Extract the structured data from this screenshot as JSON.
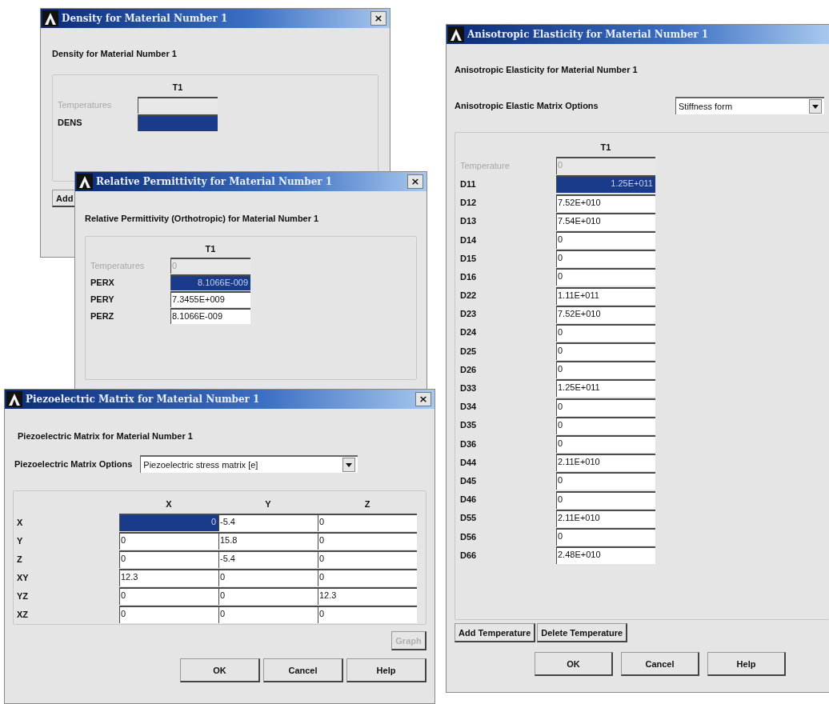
{
  "density_dialog": {
    "title": "Density for Material Number 1",
    "close_label": "×",
    "heading": "Density for Material Number 1",
    "column": "T1",
    "temperature_row": {
      "label": "Temperatures",
      "disabled": true
    },
    "rows": [
      {
        "label": "DENS",
        "selected": true
      }
    ],
    "buttons": [
      "Add"
    ]
  },
  "permittivity_dialog": {
    "title": "Relative Permittivity for Material Number 1",
    "close_label": "×",
    "heading": "Relative Permittivity (Orthotropic) for Material Number 1",
    "column": "T1",
    "temperature_row": {
      "label": "Temperatures",
      "value": "0",
      "disabled": true
    },
    "rows": [
      {
        "label": "PERX",
        "value": "8.1066E-009",
        "selected": true
      },
      {
        "label": "PERY",
        "value": "7.3455E+009",
        "selected": false
      },
      {
        "label": "PERZ",
        "value": "8.1066E-009",
        "selected": false
      }
    ]
  },
  "piezo_dialog": {
    "title": "Piezoelectric Matrix for Material Number 1",
    "close_label": "×",
    "heading": "Piezoelectric Matrix for Material Number 1",
    "options_label": "Piezoelectric Matrix Options",
    "options_value": "Piezoelectric stress matrix [e]",
    "columns": [
      "X",
      "Y",
      "Z"
    ],
    "rows": [
      {
        "label": "X",
        "cells": [
          {
            "value": "0",
            "selected": true
          },
          {
            "value": "-5.4",
            "selected": false
          },
          {
            "value": "0",
            "selected": false
          }
        ]
      },
      {
        "label": "Y",
        "cells": [
          {
            "value": "0",
            "selected": false
          },
          {
            "value": "15.8",
            "selected": false
          },
          {
            "value": "0",
            "selected": false
          }
        ]
      },
      {
        "label": "Z",
        "cells": [
          {
            "value": "0",
            "selected": false
          },
          {
            "value": "-5.4",
            "selected": false
          },
          {
            "value": "0",
            "selected": false
          }
        ]
      },
      {
        "label": "XY",
        "cells": [
          {
            "value": "12.3",
            "selected": false
          },
          {
            "value": "0",
            "selected": false
          },
          {
            "value": "0",
            "selected": false
          }
        ]
      },
      {
        "label": "YZ",
        "cells": [
          {
            "value": "0",
            "selected": false
          },
          {
            "value": "0",
            "selected": false
          },
          {
            "value": "12.3",
            "selected": false
          }
        ]
      },
      {
        "label": "XZ",
        "cells": [
          {
            "value": "0",
            "selected": false
          },
          {
            "value": "0",
            "selected": false
          },
          {
            "value": "0",
            "selected": false
          }
        ]
      }
    ],
    "graph_button": {
      "label": "Graph",
      "disabled": true
    },
    "buttons": [
      "OK",
      "Cancel",
      "Help"
    ]
  },
  "elasticity_dialog": {
    "title": "Anisotropic Elasticity  for Material Number 1",
    "heading": "Anisotropic Elasticity  for Material Number 1",
    "options_label": "Anisotropic Elastic Matrix Options",
    "options_value": "Stiffness form",
    "column": "T1",
    "temperature_row": {
      "label": "Temperature",
      "value": "0",
      "disabled": true
    },
    "rows": [
      {
        "label": "D11",
        "value": "1.25E+011",
        "selected": true
      },
      {
        "label": "D12",
        "value": "7.52E+010",
        "selected": false
      },
      {
        "label": "D13",
        "value": "7.54E+010",
        "selected": false
      },
      {
        "label": "D14",
        "value": "0",
        "selected": false
      },
      {
        "label": "D15",
        "value": "0",
        "selected": false
      },
      {
        "label": "D16",
        "value": "0",
        "selected": false
      },
      {
        "label": "D22",
        "value": "1.11E+011",
        "selected": false
      },
      {
        "label": "D23",
        "value": "7.52E+010",
        "selected": false
      },
      {
        "label": "D24",
        "value": "0",
        "selected": false
      },
      {
        "label": "D25",
        "value": "0",
        "selected": false
      },
      {
        "label": "D26",
        "value": "0",
        "selected": false
      },
      {
        "label": "D33",
        "value": "1.25E+011",
        "selected": false
      },
      {
        "label": "D34",
        "value": "0",
        "selected": false
      },
      {
        "label": "D35",
        "value": "0",
        "selected": false
      },
      {
        "label": "D36",
        "value": "0",
        "selected": false
      },
      {
        "label": "D44",
        "value": "2.11E+010",
        "selected": false
      },
      {
        "label": "D45",
        "value": "0",
        "selected": false
      },
      {
        "label": "D46",
        "value": "0",
        "selected": false
      },
      {
        "label": "D55",
        "value": "2.11E+010",
        "selected": false
      },
      {
        "label": "D56",
        "value": "0",
        "selected": false
      },
      {
        "label": "D66",
        "value": "2.48E+010",
        "selected": false
      }
    ],
    "temperature_buttons": [
      "Add Temperature",
      "Delete Temperature"
    ],
    "buttons": [
      "OK",
      "Cancel",
      "Help"
    ]
  }
}
